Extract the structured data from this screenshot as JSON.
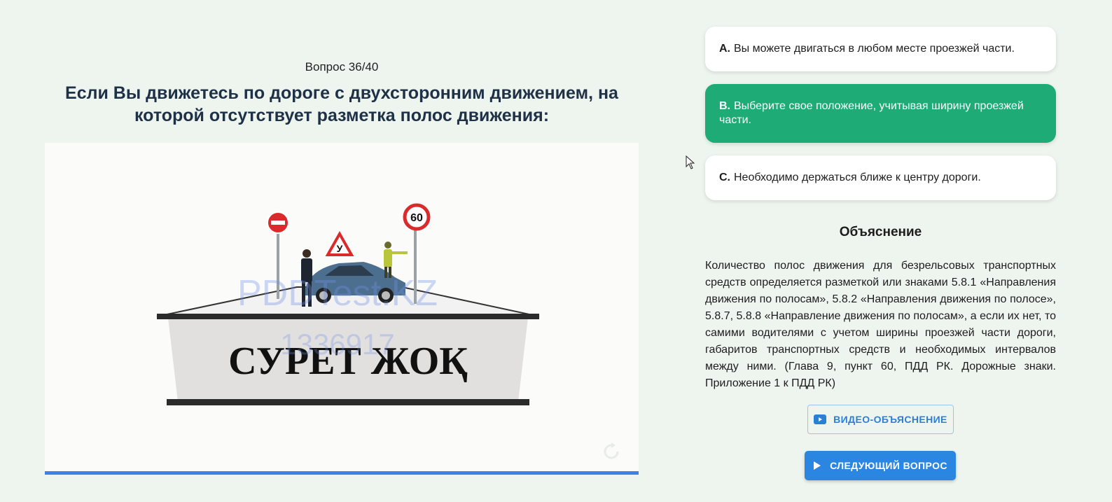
{
  "quiz": {
    "counter": "Вопрос 36/40",
    "question": "Если Вы движетесь по дороге с двухсторонним движением, на которой отсутствует разметка полос движения:"
  },
  "media": {
    "placeholder_text": "СУРЕТ ЖОҚ",
    "watermark_brand": "PDDTest.KZ",
    "watermark_id": "1336917",
    "sign_speed_limit": "60",
    "sign_learner": "У",
    "icons": [
      "replay-icon"
    ],
    "progress": 1.0
  },
  "options": [
    {
      "letter": "A.",
      "text": "Вы можете двигаться в любом месте проезжей части.",
      "state": "default"
    },
    {
      "letter": "B.",
      "text": "Выберите свое положение, учитывая ширину проезжей части.",
      "state": "correct"
    },
    {
      "letter": "C.",
      "text": "Необходимо держаться ближе к центру дороги.",
      "state": "default"
    }
  ],
  "explanation": {
    "title": "Объяснение",
    "text": "Количество полос движения для безрельсовых транспортных средств определяется разметкой или знаками 5.8.1 «Направления движения по полосам», 5.8.2 «Направления движения по полосе», 5.8.7, 5.8.8 «Направление движения по полосам», а если их нет, то самими водителями с учетом ширины проезжей части дороги, габаритов транспортных средств и необходимых интервалов между ними. (Глава 9, пункт 60, ПДД РК. Дорожные знаки. Приложение 1 к ПДД РК)"
  },
  "buttons": {
    "video_label": "ВИДЕО-ОБЪЯСНЕНИЕ",
    "next_label": "СЛЕДУЮЩИЙ ВОПРОС"
  },
  "colors": {
    "background": "#eef4ee",
    "correct": "#1eab76",
    "accent": "#2a86e1"
  }
}
